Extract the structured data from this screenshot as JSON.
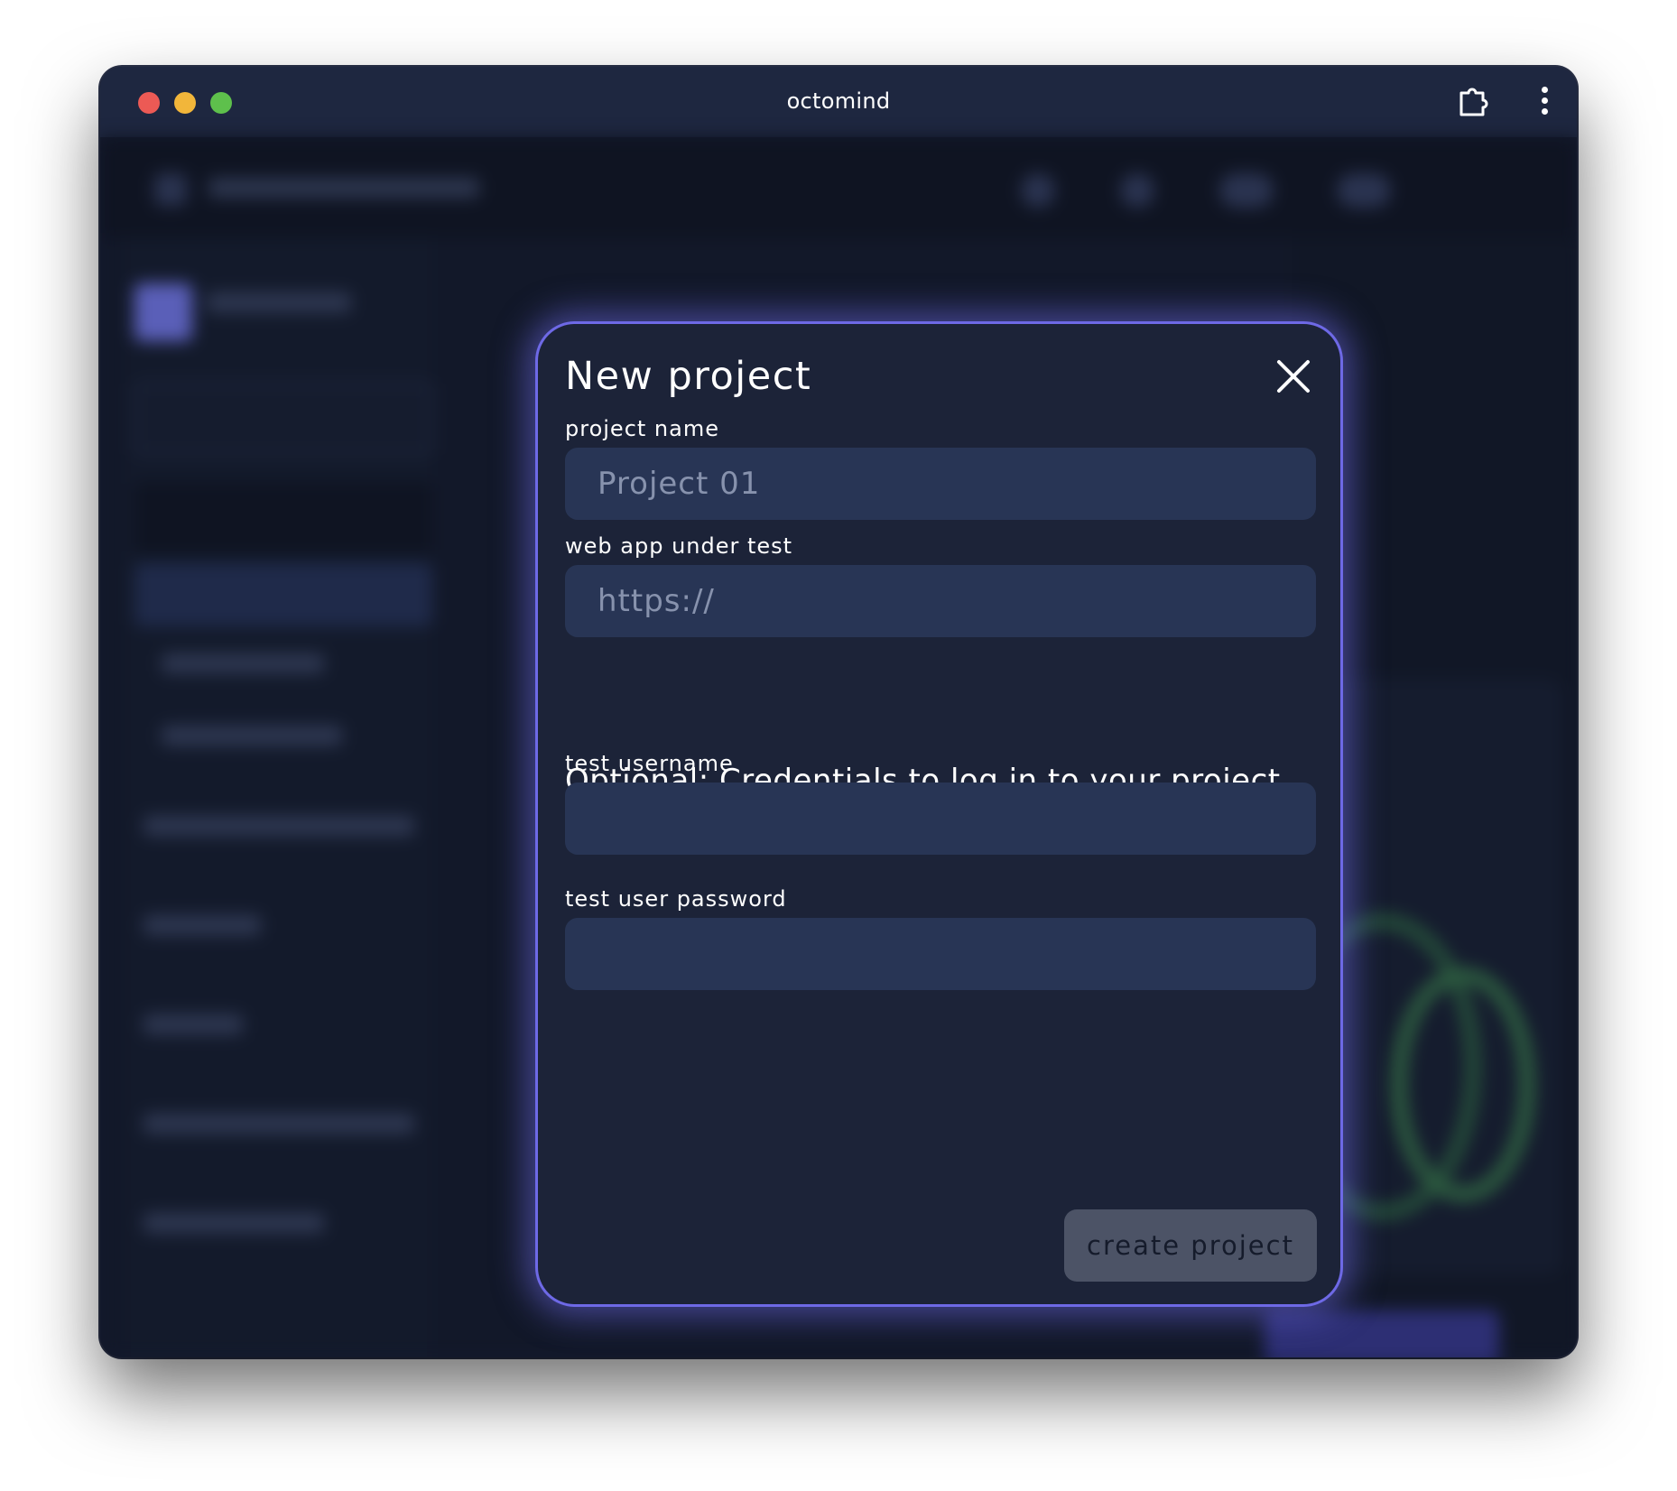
{
  "window": {
    "title": "octomind"
  },
  "modal": {
    "title": "New project",
    "fields": {
      "project_name": {
        "label": "project name",
        "placeholder": "Project 01",
        "value": ""
      },
      "web_app": {
        "label": "web app under test",
        "placeholder": "https://",
        "value": ""
      },
      "username": {
        "label": "test username",
        "placeholder": "",
        "value": ""
      },
      "password": {
        "label": "test user password",
        "placeholder": "",
        "value": ""
      }
    },
    "credentials_heading": "Optional: Credentials to log in to your project",
    "submit_label": "create project"
  },
  "icons": {
    "close": "close-icon",
    "extension": "puzzle-extension-icon",
    "menu": "kebab-menu-icon"
  },
  "colors": {
    "modal_border": "#6e69e6",
    "modal_bg": "#1c2338",
    "input_bg": "#283555",
    "disabled_button": "#4c5366"
  }
}
